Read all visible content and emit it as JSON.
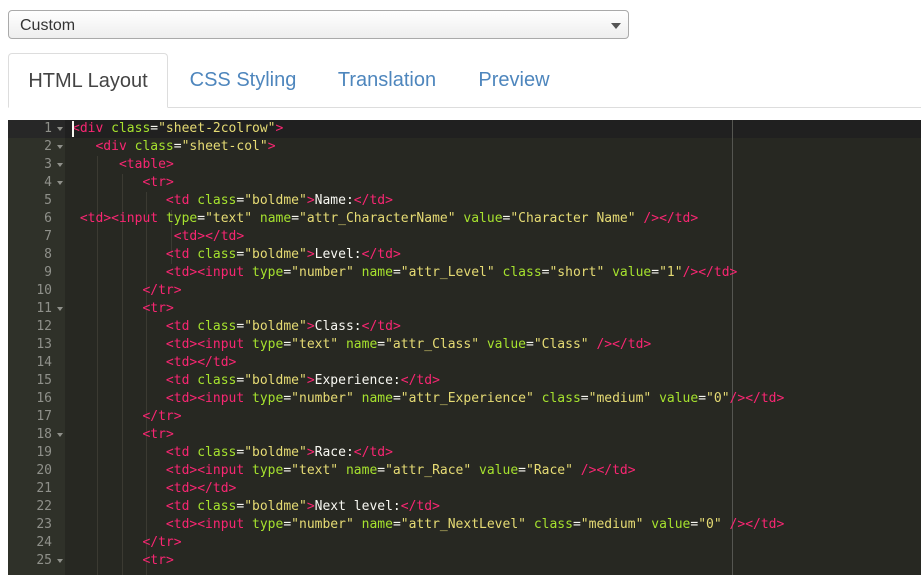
{
  "select": {
    "value": "Custom"
  },
  "tabs": [
    {
      "label": "HTML Layout",
      "active": true
    },
    {
      "label": "CSS Styling",
      "active": false
    },
    {
      "label": "Translation",
      "active": false
    },
    {
      "label": "Preview",
      "active": false
    }
  ],
  "editor": {
    "theme": {
      "background": "#272822",
      "gutter": "#2f3129",
      "tag": "#f92672",
      "attribute": "#a6e22e",
      "string": "#e6db74",
      "text": "#f8f8f2"
    },
    "lines": [
      {
        "n": "1",
        "fold": true,
        "code": "<div class=\"sheet-2colrow\">"
      },
      {
        "n": "2",
        "fold": true,
        "code": "   <div class=\"sheet-col\">"
      },
      {
        "n": "3",
        "fold": true,
        "code": "      <table>"
      },
      {
        "n": "4",
        "fold": true,
        "code": "         <tr>"
      },
      {
        "n": "5",
        "fold": false,
        "code": "            <td class=\"boldme\">Name:</td>"
      },
      {
        "n": "6",
        "fold": false,
        "code": " <td><input type=\"text\" name=\"attr_CharacterName\" value=\"Character Name\" /></td>"
      },
      {
        "n": "7",
        "fold": false,
        "code": "             <td></td>"
      },
      {
        "n": "8",
        "fold": false,
        "code": "            <td class=\"boldme\">Level:</td>"
      },
      {
        "n": "9",
        "fold": false,
        "code": "            <td><input type=\"number\" name=\"attr_Level\" class=\"short\" value=\"1\"/></td>"
      },
      {
        "n": "10",
        "fold": false,
        "code": "         </tr>"
      },
      {
        "n": "11",
        "fold": true,
        "code": "         <tr>"
      },
      {
        "n": "12",
        "fold": false,
        "code": "            <td class=\"boldme\">Class:</td>"
      },
      {
        "n": "13",
        "fold": false,
        "code": "            <td><input type=\"text\" name=\"attr_Class\" value=\"Class\" /></td>"
      },
      {
        "n": "14",
        "fold": false,
        "code": "            <td></td>"
      },
      {
        "n": "15",
        "fold": false,
        "code": "            <td class=\"boldme\">Experience:</td>"
      },
      {
        "n": "16",
        "fold": false,
        "code": "            <td><input type=\"number\" name=\"attr_Experience\" class=\"medium\" value=\"0\"/></td>"
      },
      {
        "n": "17",
        "fold": false,
        "code": "         </tr>"
      },
      {
        "n": "18",
        "fold": true,
        "code": "         <tr>"
      },
      {
        "n": "19",
        "fold": false,
        "code": "            <td class=\"boldme\">Race:</td>"
      },
      {
        "n": "20",
        "fold": false,
        "code": "            <td><input type=\"text\" name=\"attr_Race\" value=\"Race\" /></td>"
      },
      {
        "n": "21",
        "fold": false,
        "code": "            <td></td>"
      },
      {
        "n": "22",
        "fold": false,
        "code": "            <td class=\"boldme\">Next level:</td>"
      },
      {
        "n": "23",
        "fold": false,
        "code": "            <td><input type=\"number\" name=\"attr_NextLevel\" class=\"medium\" value=\"0\" /></td>"
      },
      {
        "n": "24",
        "fold": false,
        "code": "         </tr>"
      },
      {
        "n": "25",
        "fold": true,
        "code": "         <tr>"
      }
    ]
  }
}
